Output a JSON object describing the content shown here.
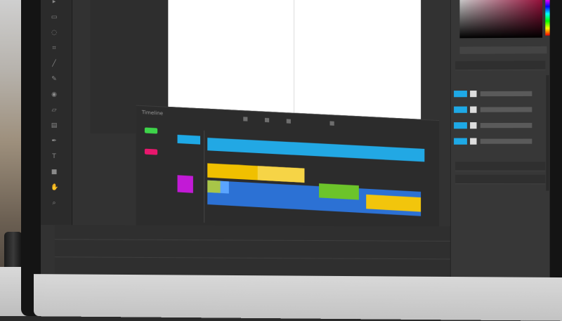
{
  "scene": {
    "description_visible": "",
    "monitor_brand": ""
  },
  "tools": {
    "icons": [
      "move-icon",
      "marquee-icon",
      "lasso-icon",
      "crop-icon",
      "eyedropper-icon",
      "brush-icon",
      "clone-icon",
      "eraser-icon",
      "gradient-icon",
      "pen-icon",
      "text-icon",
      "shape-icon",
      "hand-icon",
      "zoom-icon"
    ]
  },
  "timeline": {
    "panel_label": "Timeline",
    "clip_cyan_label": "",
    "track_colors": {
      "green": "#3ed44a",
      "magenta": "#e8176d",
      "cyan": "#1ea9e6",
      "purple": "#c21ad6",
      "yellow": "#f0c000",
      "blue": "#2c71d4",
      "lime": "#6cc42a"
    }
  },
  "right_panel": {
    "swatches_label": "",
    "properties_label": "",
    "layers": [
      "Layer",
      "Layer",
      "Layer",
      "Layer"
    ],
    "extra_rows": [
      "",
      ""
    ]
  },
  "colors": {
    "app_bg": "#323232",
    "panel_bg": "#373737",
    "accent": "#1ea9e6"
  }
}
